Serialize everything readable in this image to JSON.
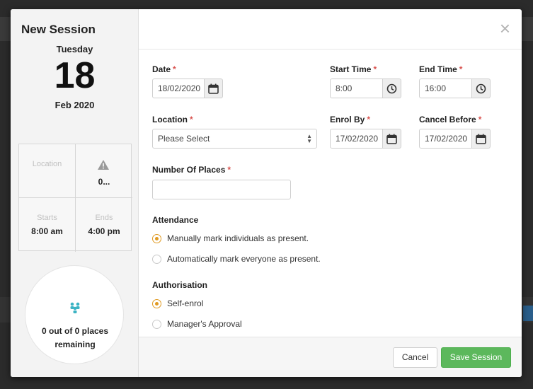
{
  "modal": {
    "title": "New Session",
    "close_symbol": "×"
  },
  "sidebar": {
    "day_name": "Tuesday",
    "day_number": "18",
    "month_year": "Feb 2020",
    "location_label": "Location",
    "warning_value": "0...",
    "starts_label": "Starts",
    "starts_value": "8:00 am",
    "ends_label": "Ends",
    "ends_value": "4:00 pm",
    "places_line1": "0 out of 0 places",
    "places_line2": "remaining",
    "warning_icon": "warning-triangle-icon",
    "people_icon": "people-icon"
  },
  "form": {
    "date_label": "Date",
    "date_value": "18/02/2020",
    "start_time_label": "Start Time",
    "start_time_value": "8:00",
    "end_time_label": "End Time",
    "end_time_value": "16:00",
    "location_label": "Location",
    "location_value": "Please Select",
    "enrol_by_label": "Enrol By",
    "enrol_by_value": "17/02/2020",
    "cancel_before_label": "Cancel Before",
    "cancel_before_value": "17/02/2020",
    "places_label": "Number Of Places",
    "places_value": "",
    "required_mark": "*"
  },
  "attendance": {
    "label": "Attendance",
    "options": [
      {
        "text": "Manually mark individuals as present.",
        "selected": true
      },
      {
        "text": "Automatically mark everyone as present.",
        "selected": false
      }
    ]
  },
  "authorisation": {
    "label": "Authorisation",
    "options": [
      {
        "text": "Self-enrol",
        "selected": true
      },
      {
        "text": "Manager's Approval",
        "selected": false
      }
    ]
  },
  "footer": {
    "cancel_label": "Cancel",
    "save_label": "Save Session"
  },
  "colors": {
    "accent_radio": "#e09a22",
    "save_button": "#5cb85c",
    "required": "#d9534f",
    "people_icon": "#3bb3c3"
  }
}
